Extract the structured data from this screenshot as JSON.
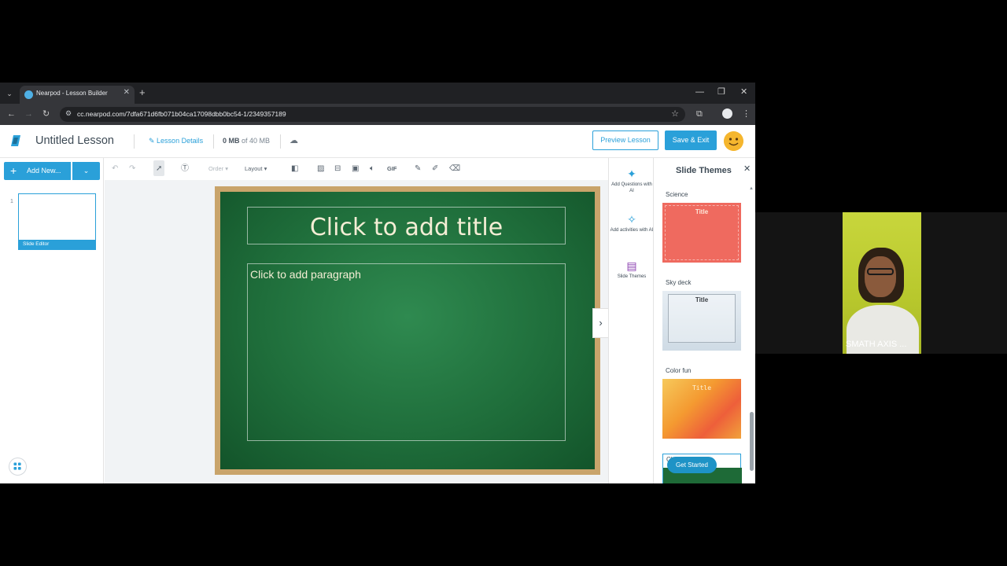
{
  "browser": {
    "tab_title": "Nearpod - Lesson Builder",
    "url": "cc.nearpod.com/7dfa671d6fb071b04ca17098dbb0bc54-1/2349357189"
  },
  "header": {
    "lesson_title": "Untitled Lesson",
    "lesson_details": "Lesson Details",
    "storage_used": "0 MB",
    "storage_total": "of 40 MB",
    "preview_label": "Preview Lesson",
    "save_label": "Save & Exit"
  },
  "left_panel": {
    "add_new_label": "Add New...",
    "slides": [
      {
        "number": "1",
        "label": "Slide Editor"
      }
    ]
  },
  "editor_toolbar": {
    "order_label": "Order",
    "layout_label": "Layout",
    "gif_label": "GIF"
  },
  "slide": {
    "title_placeholder": "Click to add title",
    "paragraph_placeholder": "Click to add paragraph"
  },
  "right_rail": {
    "items": [
      {
        "label": "Add Questions with AI",
        "icon": "sparkles-icon"
      },
      {
        "label": "Add activities with AI",
        "icon": "magic-wand-icon"
      },
      {
        "label": "Slide Themes",
        "icon": "paint-roller-icon"
      }
    ]
  },
  "themes_panel": {
    "title": "Slide Themes",
    "themes": [
      {
        "name": "Science",
        "preview_title": "Title",
        "color": "#ef6a5f"
      },
      {
        "name": "Sky deck",
        "preview_title": "Title",
        "color": "#dfe7ee"
      },
      {
        "name": "Color fun",
        "preview_title": "Title",
        "color": "#f59a2f"
      },
      {
        "name": "Chalkboard",
        "preview_title": "",
        "color": "#1e6a37"
      }
    ],
    "get_started_label": "Get Started"
  },
  "video": {
    "participant_name": "SMATH AXIS ..."
  },
  "colors": {
    "accent": "#2aa0d9",
    "chalkboard": "#1f6e3b"
  }
}
